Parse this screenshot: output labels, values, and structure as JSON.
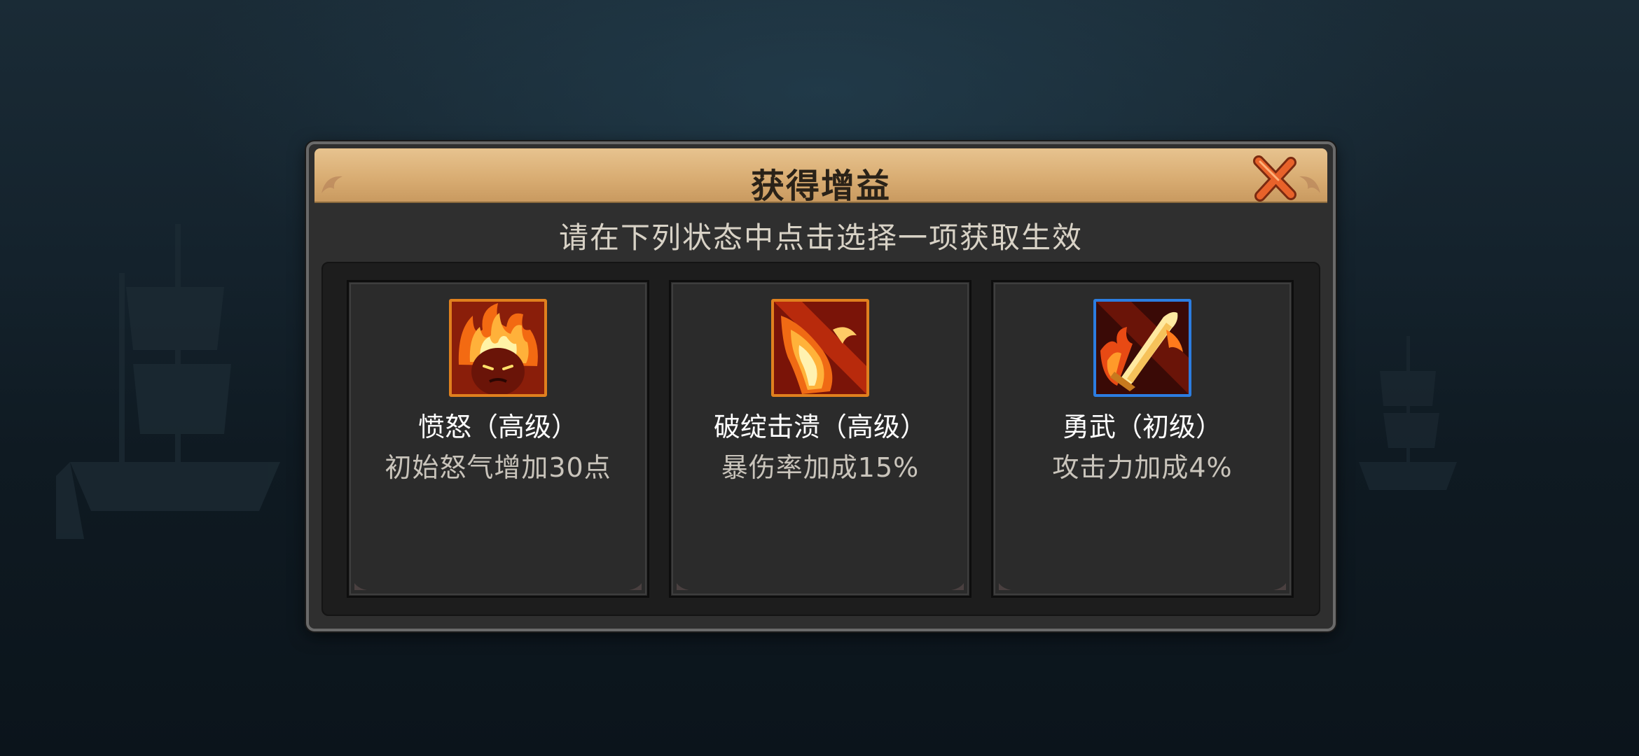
{
  "dialog": {
    "title": "获得增益",
    "subtitle": "请在下列状态中点击选择一项获取生效"
  },
  "buffs": [
    {
      "name": "愤怒（高级）",
      "desc": "初始怒气增加30点",
      "icon": "flaming-face-icon",
      "frame_color": "#e0801e"
    },
    {
      "name": "破绽击溃（高级）",
      "desc": "暴伤率加成15%",
      "icon": "fire-slash-icon",
      "frame_color": "#e0801e"
    },
    {
      "name": "勇武（初级）",
      "desc": "攻击力加成4%",
      "icon": "flaming-sword-icon",
      "frame_color": "#2c7de0"
    }
  ]
}
